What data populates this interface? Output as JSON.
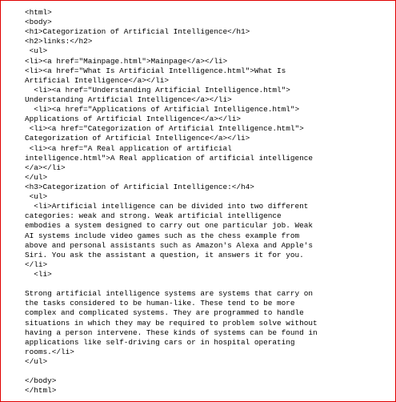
{
  "document": {
    "lines": [
      "<html>",
      "<body>",
      "<h1>Categorization of Artificial Intelligence</h1>",
      "<h2>links:</h2>",
      " <ul>",
      "<li><a href=\"Mainpage.html\">Mainpage</a></li>",
      "<li><a href=\"What Is Artificial Intelligence.html\">What Is",
      "Artificial Intelligence</a></li>",
      "  <li><a href=\"Understanding Artificial Intelligence.html\">",
      "Understanding Artificial Intelligence</a></li>",
      "  <li><a href=\"Applications of Artificial Intelligence.html\">",
      "Applications of Artificial Intelligence</a></li>",
      " <li><a href=\"Categorization of Artificial Intelligence.html\">",
      "Categorization of Artificial Intelligence</a></li>",
      " <li><a href=\"A Real application of artificial",
      "intelligence.html\">A Real application of artificial intelligence",
      "</a></li>",
      "</ul>",
      "<h3>Categorization of Artificial Intelligence:</h4>",
      " <ul>",
      "  <li>Artificial intelligence can be divided into two different",
      "categories: weak and strong. Weak artificial intelligence",
      "embodies a system designed to carry out one particular job. Weak",
      "AI systems include video games such as the chess example from",
      "above and personal assistants such as Amazon's Alexa and Apple's",
      "Siri. You ask the assistant a question, it answers it for you.",
      "</li>",
      "  <li>",
      "",
      "Strong artificial intelligence systems are systems that carry on",
      "the tasks considered to be human-like. These tend to be more",
      "complex and complicated systems. They are programmed to handle",
      "situations in which they may be required to problem solve without",
      "having a person intervene. These kinds of systems can be found in",
      "applications like self-driving cars or in hospital operating",
      "rooms.</li>",
      "</ul>",
      "",
      "</body>",
      "</html>"
    ]
  }
}
